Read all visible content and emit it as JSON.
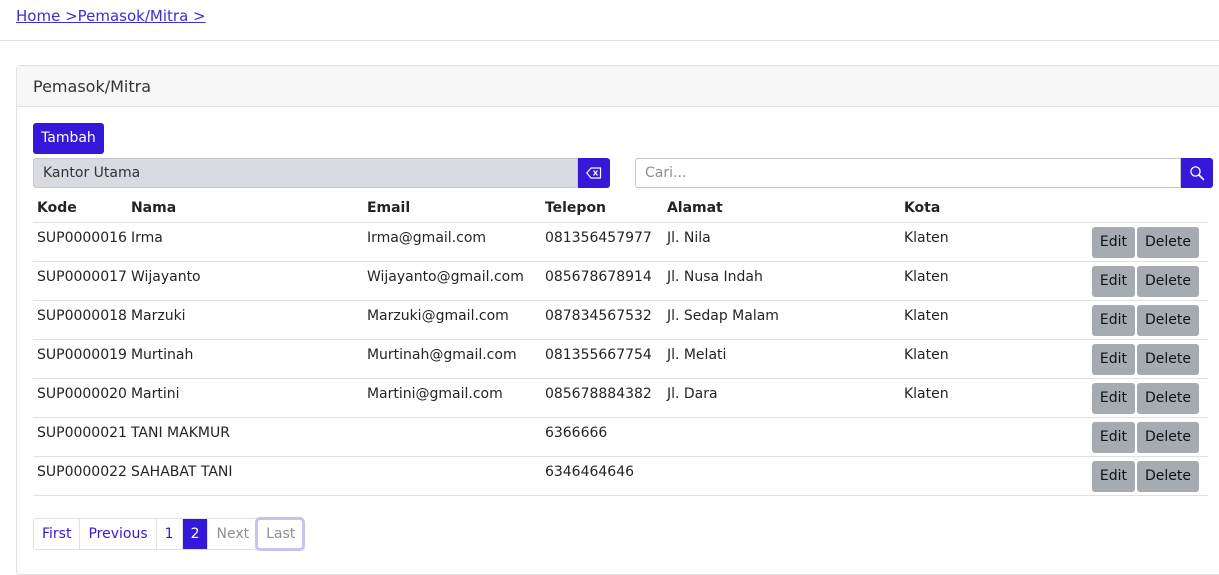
{
  "breadcrumb": {
    "text": "Home >Pemasok/Mitra >"
  },
  "card": {
    "title": "Pemasok/Mitra"
  },
  "toolbar": {
    "add_label": "Tambah"
  },
  "filter": {
    "selected_value": "Kantor Utama",
    "clear_icon": "backspace-icon"
  },
  "search": {
    "placeholder": "Cari...",
    "icon": "search-icon"
  },
  "table": {
    "columns": [
      "Kode",
      "Nama",
      "Email",
      "Telepon",
      "Alamat",
      "Kota"
    ],
    "edit_label": "Edit",
    "delete_label": "Delete",
    "rows": [
      {
        "kode": "SUP0000016",
        "nama": "Irma",
        "email": "Irma@gmail.com",
        "telepon": "081356457977",
        "alamat": "Jl. Nila",
        "kota": "Klaten"
      },
      {
        "kode": "SUP0000017",
        "nama": "Wijayanto",
        "email": "Wijayanto@gmail.com",
        "telepon": "085678678914",
        "alamat": "Jl. Nusa Indah",
        "kota": "Klaten"
      },
      {
        "kode": "SUP0000018",
        "nama": "Marzuki",
        "email": "Marzuki@gmail.com",
        "telepon": "087834567532",
        "alamat": "Jl. Sedap Malam",
        "kota": "Klaten"
      },
      {
        "kode": "SUP0000019",
        "nama": "Murtinah",
        "email": "Murtinah@gmail.com",
        "telepon": "081355667754",
        "alamat": "Jl. Melati",
        "kota": "Klaten"
      },
      {
        "kode": "SUP0000020",
        "nama": "Martini",
        "email": "Martini@gmail.com",
        "telepon": "085678884382",
        "alamat": "Jl. Dara",
        "kota": "Klaten"
      },
      {
        "kode": "SUP0000021",
        "nama": "TANI MAKMUR",
        "email": "",
        "telepon": "6366666",
        "alamat": "",
        "kota": ""
      },
      {
        "kode": "SUP0000022",
        "nama": "SAHABAT TANI",
        "email": "",
        "telepon": "6346464646",
        "alamat": "",
        "kota": ""
      }
    ]
  },
  "pagination": {
    "first": "First",
    "previous": "Previous",
    "pages": [
      "1",
      "2"
    ],
    "current": "2",
    "next": "Next",
    "last": "Last"
  },
  "colors": {
    "accent": "#3419d9",
    "muted_button": "#a6abb2"
  }
}
